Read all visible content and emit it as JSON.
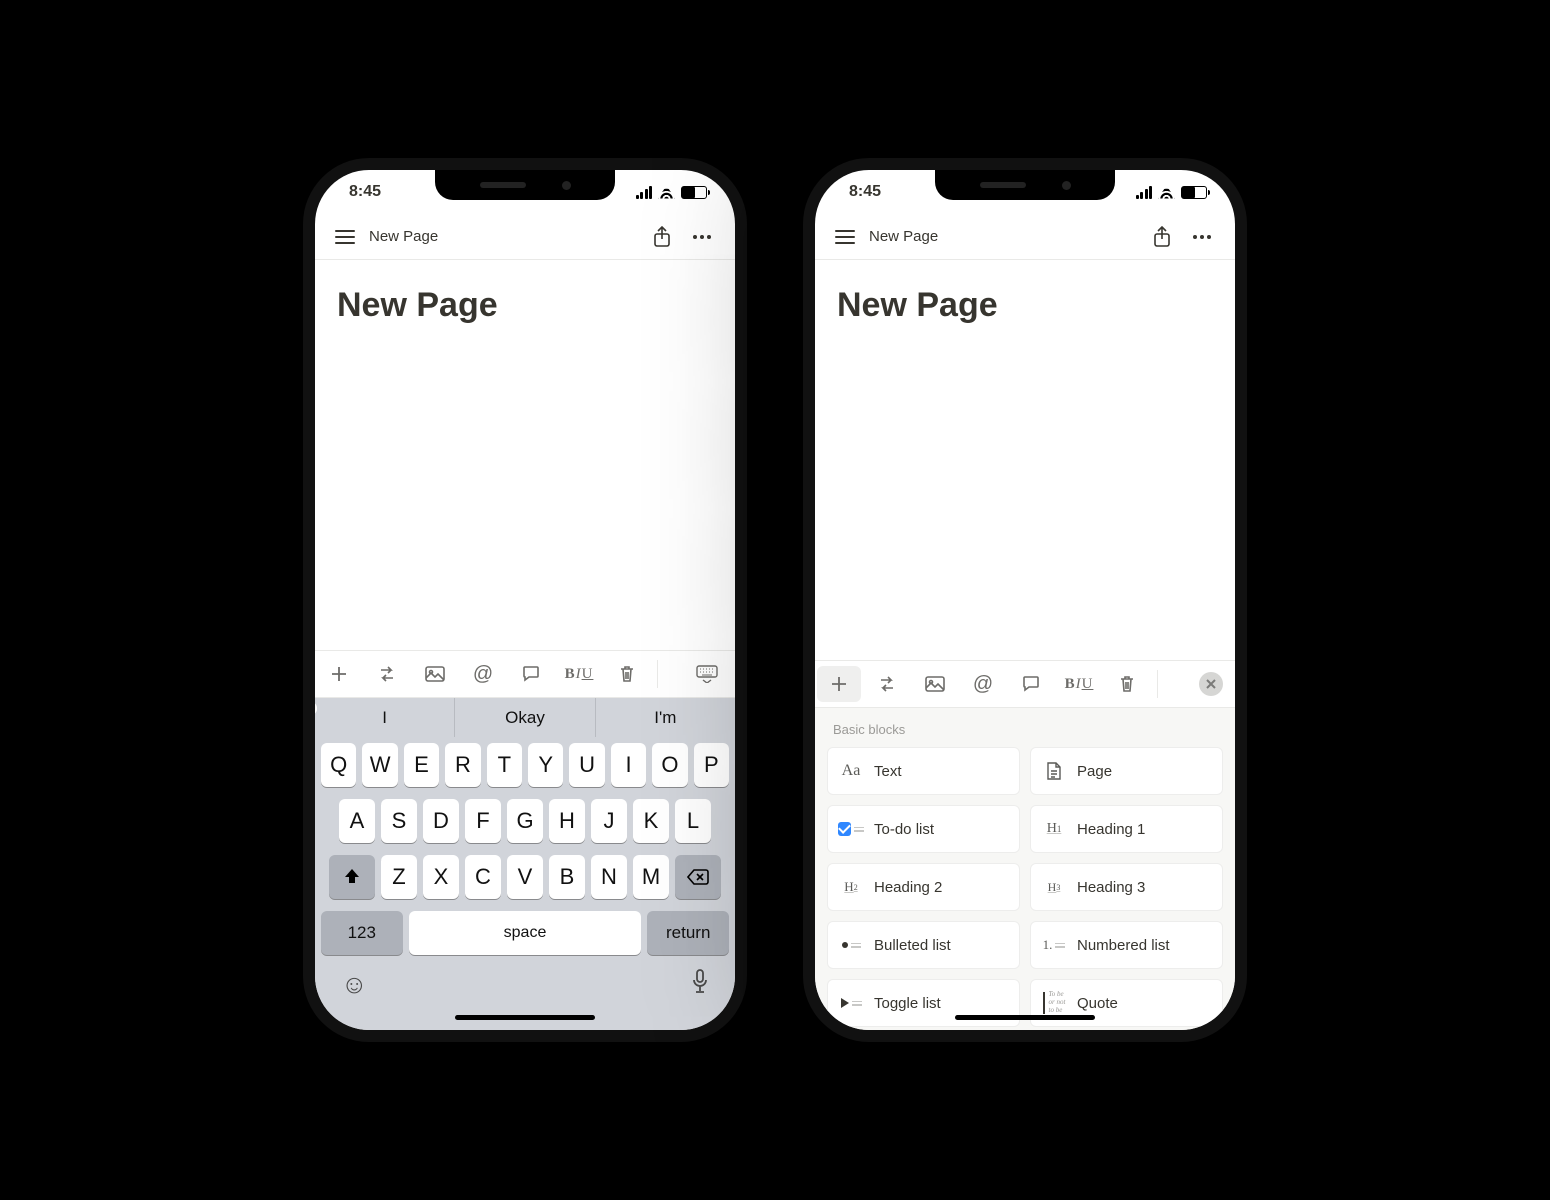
{
  "status": {
    "time": "8:45"
  },
  "header": {
    "breadcrumb": "New Page"
  },
  "page": {
    "title": "New Page"
  },
  "toolbar": {
    "items": [
      "plus",
      "turn-into",
      "image",
      "mention",
      "comment",
      "style",
      "trash"
    ]
  },
  "keyboard": {
    "suggestions": [
      "I",
      "Okay",
      "I'm"
    ],
    "row1": [
      "Q",
      "W",
      "E",
      "R",
      "T",
      "Y",
      "U",
      "I",
      "O",
      "P"
    ],
    "row2": [
      "A",
      "S",
      "D",
      "F",
      "G",
      "H",
      "J",
      "K",
      "L"
    ],
    "row3": [
      "Z",
      "X",
      "C",
      "V",
      "B",
      "N",
      "M"
    ],
    "numKey": "123",
    "spaceKey": "space",
    "returnKey": "return"
  },
  "picker": {
    "heading": "Basic blocks",
    "blocks": [
      {
        "id": "text",
        "label": "Text"
      },
      {
        "id": "page",
        "label": "Page"
      },
      {
        "id": "todo",
        "label": "To-do list"
      },
      {
        "id": "h1",
        "label": "Heading 1"
      },
      {
        "id": "h2",
        "label": "Heading 2"
      },
      {
        "id": "h3",
        "label": "Heading 3"
      },
      {
        "id": "bulleted",
        "label": "Bulleted list"
      },
      {
        "id": "numbered",
        "label": "Numbered list"
      },
      {
        "id": "toggle",
        "label": "Toggle list"
      },
      {
        "id": "quote",
        "label": "Quote"
      }
    ]
  }
}
